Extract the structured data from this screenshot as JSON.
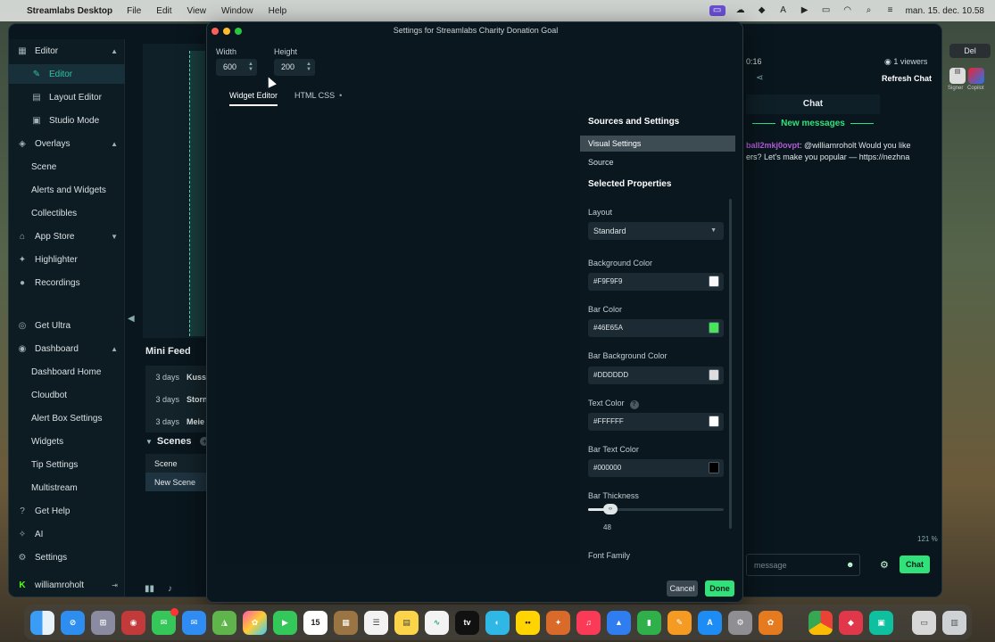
{
  "menubar": {
    "app_name": "Streamlabs Desktop",
    "menus": [
      "File",
      "Edit",
      "View",
      "Window",
      "Help"
    ],
    "clock": "man. 15. dec. 10.58"
  },
  "sidebar": {
    "items": [
      {
        "label": "Editor",
        "icon": "grid-icon",
        "chevron": "▲"
      },
      {
        "label": "Editor",
        "icon": "pencil-icon"
      },
      {
        "label": "Layout Editor",
        "icon": "layout-icon"
      },
      {
        "label": "Studio Mode",
        "icon": "studio-icon"
      },
      {
        "label": "Overlays",
        "icon": "overlays-icon",
        "chevron": "▲"
      },
      {
        "label": "Scene"
      },
      {
        "label": "Alerts and Widgets"
      },
      {
        "label": "Collectibles"
      },
      {
        "label": "App Store",
        "icon": "store-icon",
        "chevron": "▼"
      },
      {
        "label": "Highlighter",
        "icon": "highlighter-icon"
      },
      {
        "label": "Recordings",
        "icon": "recordings-icon"
      },
      {
        "label": "Get Ultra",
        "icon": "ultra-icon"
      },
      {
        "label": "Dashboard",
        "icon": "dashboard-icon",
        "chevron": "▲"
      },
      {
        "label": "Dashboard Home"
      },
      {
        "label": "Cloudbot"
      },
      {
        "label": "Alert Box Settings"
      },
      {
        "label": "Widgets"
      },
      {
        "label": "Tip Settings"
      },
      {
        "label": "Multistream"
      },
      {
        "label": "Get Help",
        "icon": "help-icon"
      },
      {
        "label": "AI",
        "icon": "ai-icon"
      },
      {
        "label": "Settings",
        "icon": "gear-icon"
      },
      {
        "label": "williamroholt",
        "icon": "kick-icon"
      }
    ]
  },
  "minifeed": {
    "title": "Mini Feed",
    "rows": [
      {
        "time": "3 days",
        "name": "Kuss"
      },
      {
        "time": "3 days",
        "name": "Storn"
      },
      {
        "time": "3 days",
        "name": "Meie"
      }
    ]
  },
  "scenes": {
    "title": "Scenes",
    "items": [
      "Scene",
      "New Scene"
    ]
  },
  "chat": {
    "timer": "0:16",
    "viewers": "1 viewers",
    "refresh": "Refresh Chat",
    "title": "Chat",
    "new_messages": "New messages",
    "message_user": "ball2mkj0ovpt",
    "message_text": ": @williamroholt Would you like ers? Let's make you popular — https://nezhna",
    "zoom": "121 %",
    "input_placeholder": "message",
    "chat_button": "Chat"
  },
  "right_strip": {
    "del_label": "Del",
    "labels": [
      "Signer",
      "Copilot"
    ]
  },
  "dialog": {
    "title": "Settings for Streamlabs Charity Donation Goal",
    "width_label": "Width",
    "width_value": "600",
    "height_label": "Height",
    "height_value": "200",
    "tabs": [
      "Widget Editor",
      "HTML CSS"
    ],
    "tab_dot": "•",
    "sources_title": "Sources and Settings",
    "sources_items": [
      "Visual Settings",
      "Source"
    ],
    "selected_title": "Selected Properties",
    "layout_label": "Layout",
    "layout_value": "Standard",
    "bg_color_label": "Background Color",
    "bg_color_value": "#F9F9F9",
    "bar_color_label": "Bar Color",
    "bar_color_value": "#46E65A",
    "bar_bg_label": "Bar Background Color",
    "bar_bg_value": "#DDDDDD",
    "text_color_label": "Text Color",
    "text_color_value": "#FFFFFF",
    "bar_text_label": "Bar Text Color",
    "bar_text_value": "#000000",
    "thickness_label": "Bar Thickness",
    "thickness_value": "48",
    "font_family_label": "Font Family",
    "cancel": "Cancel",
    "done": "Done"
  },
  "colors": {
    "accent_green": "#31e27a",
    "teal_active": "#31c3a2",
    "swatches": {
      "bg": "#F9F9F9",
      "bar": "#46E65A",
      "bar_bg": "#DDDDDD",
      "text": "#FFFFFF",
      "bar_text": "#000000"
    }
  },
  "dock": {
    "calendar_day": "15",
    "tv_label": "tv",
    "apps": [
      "finder-icon",
      "safari-icon",
      "launchpad-icon",
      "photo-booth-icon",
      "messages-icon",
      "mail-icon",
      "maps-icon",
      "photos-icon",
      "facetime-icon",
      "calendar-icon",
      "notes-brown-icon",
      "reminders-icon",
      "notes-icon",
      "freeform-icon",
      "apple-tv-icon",
      "preview-icon",
      "emoji-icon",
      "game-icon",
      "music-icon",
      "keynote-icon",
      "numbers-icon",
      "pages-icon",
      "app-store-icon",
      "system-settings-icon",
      "fl-studio-icon",
      "chrome-icon",
      "unknown-red-icon",
      "streamlabs-icon",
      "drive-icon",
      "trash-icon"
    ]
  }
}
